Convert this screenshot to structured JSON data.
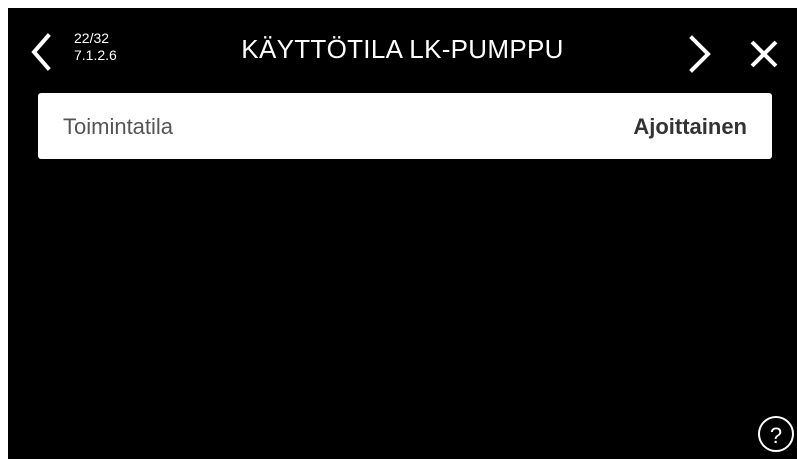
{
  "header": {
    "counter": "22/32",
    "menu_path": "7.1.2.6",
    "title": "KÄYTTÖTILA LK-PUMPPU"
  },
  "setting": {
    "label": "Toimintatila",
    "value": "Ajoittainen"
  },
  "help": {
    "symbol": "?"
  },
  "icons": {
    "back": "chevron-left-icon",
    "next": "chevron-right-icon",
    "close": "close-icon",
    "help": "question-mark-icon"
  },
  "colors": {
    "background": "#000000",
    "foreground": "#ffffff",
    "row_background": "#ffffff",
    "label_text": "#555555",
    "value_text": "#333333"
  }
}
